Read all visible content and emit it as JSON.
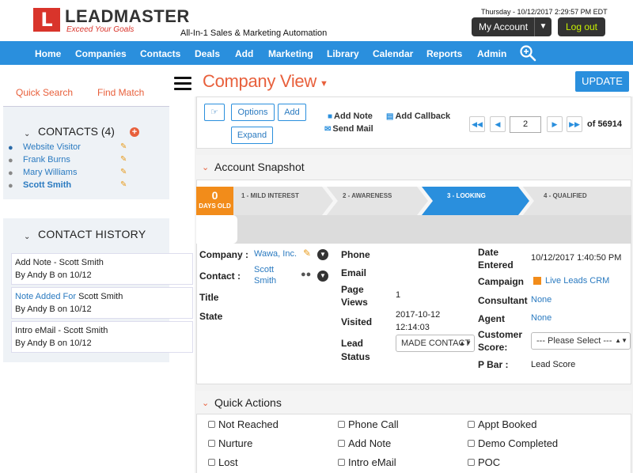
{
  "header": {
    "logo_text": "LEADMASTER",
    "logo_tagline": "Exceed Your Goals",
    "product_tagline": "All-In-1 Sales & Marketing Automation",
    "datetime": "Thursday  -  10/12/2017 2:29:57 PM EDT",
    "my_account_label": "My Account",
    "logout_label": "Log out"
  },
  "nav": {
    "items": [
      "Home",
      "Companies",
      "Contacts",
      "Deals",
      "Add",
      "Marketing",
      "Library",
      "Calendar",
      "Reports",
      "Admin"
    ],
    "search_icon": "search-icon"
  },
  "sidebar": {
    "quick_search": "Quick Search",
    "find_match": "Find Match",
    "contacts_title": "CONTACTS (4)",
    "contacts": [
      "Website Visitor",
      "Frank Burns",
      "Mary Williams",
      "Scott Smith"
    ],
    "history_title": "CONTACT HISTORY",
    "history": [
      {
        "title_a": "Add Note - Scott Smith",
        "title_hl": "",
        "title_b": "",
        "by": "By Andy B on 10/12"
      },
      {
        "title_a": "",
        "title_hl": "Note Added For",
        "title_b": " Scott Smith",
        "by": "By Andy B on 10/12"
      },
      {
        "title_a": "Intro eMail - Scott Smith",
        "title_hl": "",
        "title_b": "",
        "by": "By Andy B on 10/12"
      }
    ]
  },
  "main": {
    "title": "Company View",
    "update_label": "UPDATE",
    "toolbar": {
      "options": "Options",
      "add": "Add",
      "expand": "Expand",
      "add_note": "Add Note",
      "add_callback": "Add Callback",
      "send_mail": "Send Mail"
    },
    "pager": {
      "current": "2",
      "of_label": "of 56914"
    },
    "snapshot": {
      "title": "Account Snapshot",
      "days_old_num": "0",
      "days_old_label": "DAYS OLD",
      "stages": [
        "1 - MILD INTEREST",
        "2 - AWARENESS",
        "3 - LOOKING",
        "4 - QUALIFIED"
      ],
      "active_stage": 2,
      "company_label": "Company :",
      "company_value": "Wawa, Inc.",
      "contact_label": "Contact :",
      "contact_value_1": "Scott",
      "contact_value_2": "Smith",
      "title_label": "Title",
      "state_label": "State",
      "phone_label": "Phone",
      "email_label": "Email",
      "page_views_label_1": "Page",
      "page_views_label_2": "Views",
      "page_views_value": "1",
      "visited_label": "Visited",
      "visited_value_1": "2017-10-12",
      "visited_value_2": "12:14:03",
      "lead_status_label_1": "Lead",
      "lead_status_label_2": "Status",
      "lead_status_value": "MADE CONTACT",
      "date_entered_label_1": "Date",
      "date_entered_label_2": "Entered",
      "date_entered_value": "10/12/2017 1:40:50 PM",
      "campaign_label": "Campaign",
      "campaign_value": "Live Leads CRM",
      "consultant_label": "Consultant",
      "consultant_value": "None",
      "agent_label": "Agent",
      "agent_value": "None",
      "customer_score_label_1": "Customer",
      "customer_score_label_2": "Score:",
      "customer_score_value": "--- Please Select ---",
      "pbar_label": "P Bar :",
      "pbar_value": "Lead Score"
    },
    "quick_actions": {
      "title": "Quick Actions",
      "items": [
        "Not Reached",
        "Phone Call",
        "Appt Booked",
        "Nurture",
        "Add Note",
        "Demo Completed",
        "Lost",
        "Intro eMail",
        "POC"
      ]
    }
  },
  "colors": {
    "accent_blue": "#2a8fdd",
    "accent_orange": "#e8603c",
    "days_orange": "#f28c1a",
    "logout_text": "#c8f000"
  }
}
